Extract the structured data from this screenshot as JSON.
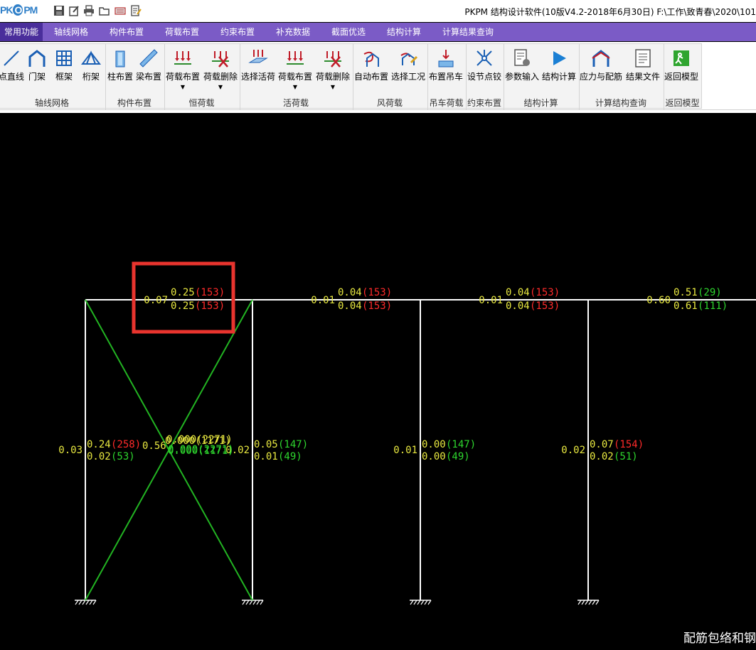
{
  "window": {
    "app_logo": "PKPM",
    "title": "PKPM 结构设计软件(10版V4.2-2018年6月30日) F:\\工作\\致青春\\2020\\101"
  },
  "quick_access": [
    "save-icon",
    "edit-icon",
    "print-icon",
    "open-folder-icon",
    "keyboard-icon",
    "notes-icon"
  ],
  "menu_tabs": [
    {
      "label": "常用功能",
      "active": true
    },
    {
      "label": "轴线网格",
      "active": false
    },
    {
      "label": "构件布置",
      "active": false
    },
    {
      "label": "荷载布置",
      "active": false
    },
    {
      "label": "约束布置",
      "active": false
    },
    {
      "label": "补充数据",
      "active": false
    },
    {
      "label": "截面优选",
      "active": false
    },
    {
      "label": "结构计算",
      "active": false
    },
    {
      "label": "计算结果查询",
      "active": false
    }
  ],
  "ribbon_groups": [
    {
      "label": "轴线网格",
      "tools": [
        {
          "label": "点直线",
          "icon": "line-icon"
        },
        {
          "label": "门架",
          "icon": "portal-frame-icon"
        },
        {
          "label": "框架",
          "icon": "grid-frame-icon"
        },
        {
          "label": "桁架",
          "icon": "truss-icon"
        }
      ]
    },
    {
      "label": "构件布置",
      "tools": [
        {
          "label": "柱布置",
          "icon": "column-icon"
        },
        {
          "label": "梁布置",
          "icon": "beam-icon"
        }
      ]
    },
    {
      "label": "恒荷载",
      "tools": [
        {
          "label": "荷载布置",
          "icon": "load-arrows-icon",
          "dropdown": true
        },
        {
          "label": "荷载删除",
          "icon": "load-delete-icon",
          "dropdown": true
        }
      ]
    },
    {
      "label": "活荷载",
      "tools": [
        {
          "label": "选择活荷",
          "icon": "select-live-load-icon"
        },
        {
          "label": "荷载布置",
          "icon": "load-arrows-icon",
          "dropdown": true
        },
        {
          "label": "荷载删除",
          "icon": "load-delete-icon",
          "dropdown": true
        }
      ]
    },
    {
      "label": "风荷载",
      "tools": [
        {
          "label": "自动布置",
          "icon": "wind-auto-icon"
        },
        {
          "label": "选择工况",
          "icon": "wind-case-icon"
        }
      ]
    },
    {
      "label": "吊车荷载",
      "tools": [
        {
          "label": "布置吊车",
          "icon": "crane-icon"
        }
      ]
    },
    {
      "label": "约束布置",
      "tools": [
        {
          "label": "设节点铰",
          "icon": "hinge-icon"
        }
      ]
    },
    {
      "label": "结构计算",
      "tools": [
        {
          "label": "参数输入",
          "icon": "parameter-icon"
        },
        {
          "label": "结构计算",
          "icon": "run-icon"
        }
      ]
    },
    {
      "label": "计算结构查询",
      "tools": [
        {
          "label": "应力与配筋",
          "icon": "stress-icon"
        },
        {
          "label": "结果文件",
          "icon": "result-file-icon"
        }
      ]
    },
    {
      "label": "返回模型",
      "tools": [
        {
          "label": "返回模型",
          "icon": "exit-icon"
        }
      ]
    }
  ],
  "colors": {
    "frame": "#ffffff",
    "brace": "#22b422",
    "ratio": "#e8e840",
    "red_id": "#ff2a2a",
    "green_id": "#2ed62e",
    "highlight": "#e8342e"
  },
  "drawing": {
    "beam_labels": [
      {
        "left": "0.07",
        "top_ratio": "0.25",
        "top_id": "(153)",
        "top_id_color": "red",
        "bot_ratio": "0.25",
        "bot_id": "(153)",
        "bot_id_color": "red"
      },
      {
        "left": "0.01",
        "top_ratio": "0.04",
        "top_id": "(153)",
        "top_id_color": "red",
        "bot_ratio": "0.04",
        "bot_id": "(153)",
        "bot_id_color": "red"
      },
      {
        "left": "0.01",
        "top_ratio": "0.04",
        "top_id": "(153)",
        "top_id_color": "red",
        "bot_ratio": "0.04",
        "bot_id": "(153)",
        "bot_id_color": "red"
      },
      {
        "left": "0.60",
        "top_ratio": "0.51",
        "top_id": "(29)",
        "top_id_color": "green",
        "bot_ratio": "0.61",
        "bot_id": "(111)",
        "bot_id_color": "green"
      }
    ],
    "column_labels": [
      {
        "left": "0.03",
        "top_ratio": "0.24",
        "top_id": "(258)",
        "top_id_color": "red",
        "bot_ratio": "0.02",
        "bot_id": "(53)",
        "bot_id_color": "green"
      },
      {
        "left": "0.02",
        "top_ratio": "0.05",
        "top_id": "(147)",
        "top_id_color": "green",
        "bot_ratio": "0.01",
        "bot_id": "(49)",
        "bot_id_color": "green"
      },
      {
        "left": "0.01",
        "top_ratio": "0.00",
        "top_id": "(147)",
        "top_id_color": "green",
        "bot_ratio": "0.00",
        "bot_id": "(49)",
        "bot_id_color": "green"
      },
      {
        "left": "0.02",
        "top_ratio": "0.07",
        "top_id": "(154)",
        "top_id_color": "red",
        "bot_ratio": "0.02",
        "bot_id": "(51)",
        "bot_id_color": "green"
      }
    ],
    "brace_overlap_texts": [
      "0.56",
      "0.000(2271)",
      "0.000(2271)",
      "0.000(1171)",
      "0.000(1171)"
    ],
    "bottom_note": "配筋包络和钢"
  }
}
